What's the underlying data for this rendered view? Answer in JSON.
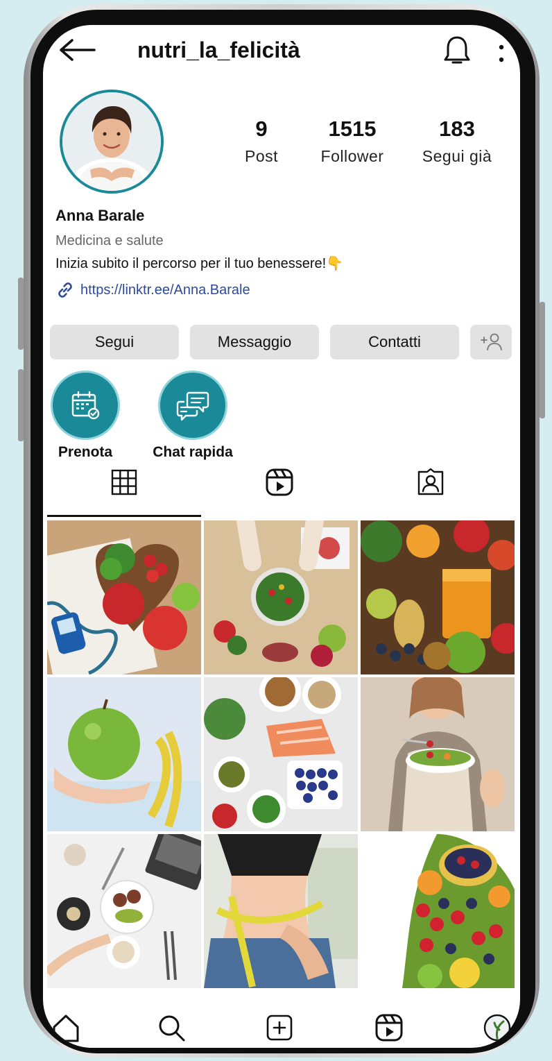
{
  "header": {
    "username": "nutri_la_felicità",
    "back_icon": "arrow-left-icon",
    "bell_icon": "bell-icon",
    "more_icon": "more-vertical-icon"
  },
  "profile": {
    "stats": [
      {
        "number": "9",
        "label": "Post"
      },
      {
        "number": "1515",
        "label": "Follower"
      },
      {
        "number": "183",
        "label": "Segui già"
      }
    ],
    "name": "Anna Barale",
    "category": "Medicina e salute",
    "bio": "Inizia subito il percorso per il tuo benessere!👇",
    "link": "https://linktr.ee/Anna.Barale"
  },
  "actions": {
    "follow": "Segui",
    "message": "Messaggio",
    "contacts": "Contatti",
    "add_person_icon": "add-person-icon"
  },
  "highlights": [
    {
      "label": "Prenota",
      "icon": "calendar-icon"
    },
    {
      "label": "Chat rapida",
      "icon": "chat-icon"
    }
  ],
  "tabs": [
    "grid-icon",
    "reels-icon",
    "tagged-icon"
  ],
  "grid": [
    {
      "subject": "cuore di verdure con glucometro e stetoscopio",
      "bg": "#c9a47a",
      "accent": "#c8272b"
    },
    {
      "subject": "insalata in ciotola su tavolo di legno",
      "bg": "#d8c09a",
      "accent": "#3c7a2b"
    },
    {
      "subject": "frutta colorata e succo d'arancia",
      "bg": "#5b3a22",
      "accent": "#f2a12e"
    },
    {
      "subject": "mela verde e metro da sarta",
      "bg": "#dfe8f2",
      "accent": "#79b83a"
    },
    {
      "subject": "salmone, mirtilli e broccoli in ciotole",
      "bg": "#e9e9e9",
      "accent": "#f08b5e"
    },
    {
      "subject": "donna che mangia un'insalata",
      "bg": "#d9cbbb",
      "accent": "#8a6f56"
    },
    {
      "subject": "tavola con piatto sano e laptop",
      "bg": "#f1f1f1",
      "accent": "#2b2b2b"
    },
    {
      "subject": "vita con metro da sarta",
      "bg": "#e4e6e0",
      "accent": "#3b6b96"
    },
    {
      "subject": "ananas ripieno di frutti di bosco",
      "bg": "#ffffff",
      "accent": "#d3222f"
    }
  ],
  "bottom_nav": [
    "home-icon",
    "search-icon",
    "new-post-icon",
    "reels-icon",
    "profile-icon"
  ],
  "colors": {
    "teal": "#1b8a98",
    "button_gray": "#e2e2e2",
    "link_blue": "#2b4a9c"
  }
}
